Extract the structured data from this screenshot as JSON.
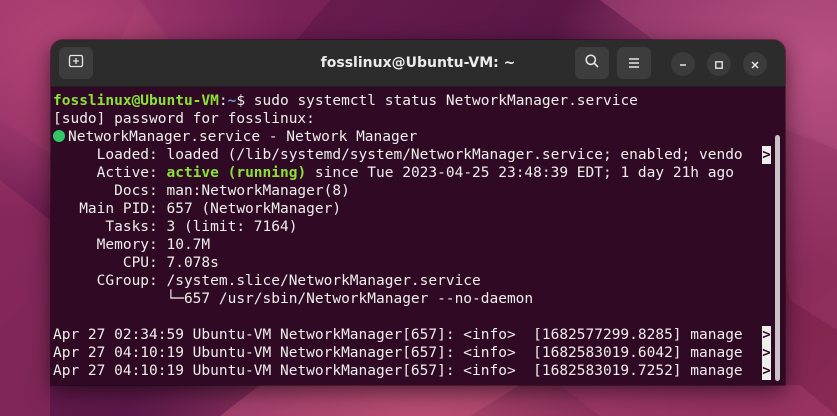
{
  "window": {
    "title": "fosslinux@Ubuntu-VM: ~"
  },
  "icons": {
    "new_tab": "new-tab-icon",
    "search": "search-icon",
    "menu": "hamburger-menu-icon",
    "minimize": "minimize-icon",
    "maximize": "maximize-icon",
    "close": "close-icon"
  },
  "terminal": {
    "prompt_user": "fosslinux@Ubuntu-VM",
    "prompt_sep": ":",
    "prompt_path": "~",
    "prompt_cmd": "$ sudo systemctl status NetworkManager.service",
    "sudo_line": "[sudo] password for fosslinux:",
    "unit_line": "NetworkManager.service - Network Manager",
    "loaded": "     Loaded: loaded (/lib/systemd/system/NetworkManager.service; enabled; vendo",
    "active_label": "     Active: ",
    "active_state": "active (running)",
    "active_rest": " since Tue 2023-04-25 23:48:39 EDT; 1 day 21h ago",
    "docs": "       Docs: man:NetworkManager(8)",
    "main_pid": "   Main PID: 657 (NetworkManager)",
    "tasks": "      Tasks: 3 (limit: 7164)",
    "memory": "     Memory: 10.7M",
    "cpu": "        CPU: 7.078s",
    "cgroup": "     CGroup: /system.slice/NetworkManager.service",
    "cgroup_child": "             └─657 /usr/sbin/NetworkManager --no-daemon",
    "log_lines": [
      "Apr 27 02:34:59 Ubuntu-VM NetworkManager[657]: <info>  [1682577299.8285] manage",
      "Apr 27 04:10:19 Ubuntu-VM NetworkManager[657]: <info>  [1682583019.6042] manage",
      "Apr 27 04:10:19 Ubuntu-VM NetworkManager[657]: <info>  [1682583019.7252] manage"
    ],
    "truncation_marker": ">"
  },
  "colors": {
    "terminal_bg": "#300a24",
    "prompt_user": "#8ae234",
    "prompt_path": "#729fcf",
    "active_green": "#8ae234",
    "status_dot": "#33c66b"
  }
}
